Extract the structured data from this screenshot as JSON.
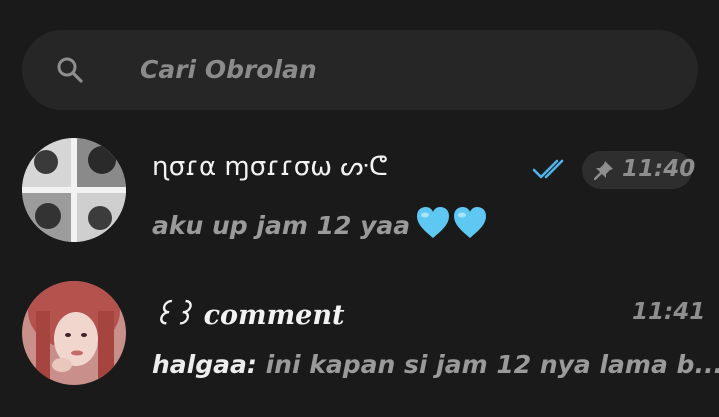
{
  "search": {
    "placeholder": "Cari Obrolan",
    "icon": "search-icon"
  },
  "chats": [
    {
      "name": "ɳσɾα ɱσɾɾσω ᔢᕦ",
      "preview": "aku up jam 12 yaa",
      "preview_emoji": "blue-heart-icon x2",
      "time": "11:40",
      "pinned": true,
      "read_status": "double-check-icon",
      "tick_color": "#4fb3ea"
    },
    {
      "name": "꒰꒱ comment",
      "preview_sender": "halgaa:",
      "preview": " ini kapan si jam 12 nya lama b...",
      "time": "11:41",
      "pinned": false
    }
  ],
  "colors": {
    "background": "#1a1a1a",
    "search_bg": "#262626",
    "accent_tick": "#4fb3ea",
    "heart": "#5ec8f2"
  }
}
